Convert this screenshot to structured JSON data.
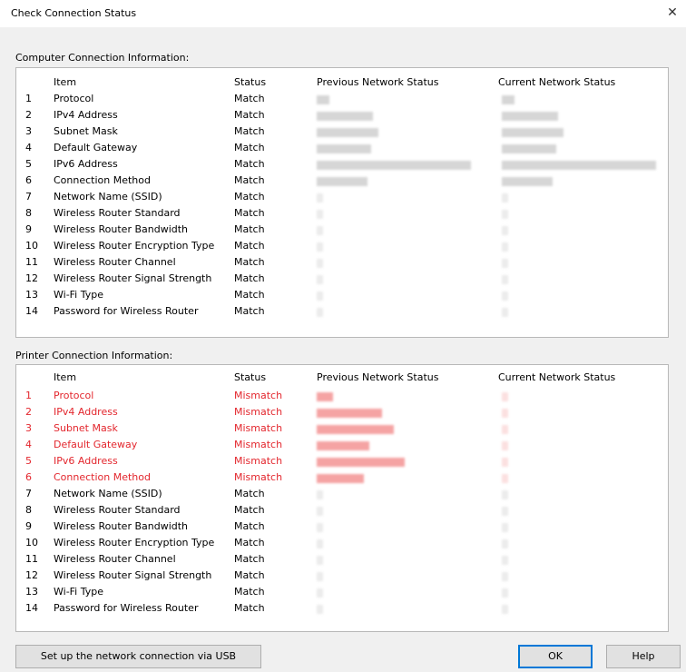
{
  "window": {
    "title": "Check Connection Status",
    "close_glyph": "✕"
  },
  "columns": {
    "item": "Item",
    "status": "Status",
    "previous": "Previous Network Status",
    "current": "Current Network Status"
  },
  "computer": {
    "label": "Computer Connection Information:",
    "rows": [
      {
        "no": "1",
        "item": "Protocol",
        "status": "Match"
      },
      {
        "no": "2",
        "item": "IPv4 Address",
        "status": "Match"
      },
      {
        "no": "3",
        "item": "Subnet Mask",
        "status": "Match"
      },
      {
        "no": "4",
        "item": "Default Gateway",
        "status": "Match"
      },
      {
        "no": "5",
        "item": "IPv6 Address",
        "status": "Match"
      },
      {
        "no": "6",
        "item": "Connection Method",
        "status": "Match"
      },
      {
        "no": "7",
        "item": "Network Name (SSID)",
        "status": "Match"
      },
      {
        "no": "8",
        "item": "Wireless Router Standard",
        "status": "Match"
      },
      {
        "no": "9",
        "item": "Wireless Router Bandwidth",
        "status": "Match"
      },
      {
        "no": "10",
        "item": "Wireless Router Encryption Type",
        "status": "Match"
      },
      {
        "no": "11",
        "item": "Wireless Router Channel",
        "status": "Match"
      },
      {
        "no": "12",
        "item": "Wireless Router Signal Strength",
        "status": "Match"
      },
      {
        "no": "13",
        "item": "Wi-Fi Type",
        "status": "Match"
      },
      {
        "no": "14",
        "item": "Password for Wireless Router",
        "status": "Match"
      }
    ]
  },
  "printer": {
    "label": "Printer Connection Information:",
    "rows": [
      {
        "no": "1",
        "item": "Protocol",
        "status": "Mismatch",
        "mismatch": true
      },
      {
        "no": "2",
        "item": "IPv4 Address",
        "status": "Mismatch",
        "mismatch": true
      },
      {
        "no": "3",
        "item": "Subnet Mask",
        "status": "Mismatch",
        "mismatch": true
      },
      {
        "no": "4",
        "item": "Default Gateway",
        "status": "Mismatch",
        "mismatch": true
      },
      {
        "no": "5",
        "item": "IPv6 Address",
        "status": "Mismatch",
        "mismatch": true
      },
      {
        "no": "6",
        "item": "Connection Method",
        "status": "Mismatch",
        "mismatch": true
      },
      {
        "no": "7",
        "item": "Network Name (SSID)",
        "status": "Match"
      },
      {
        "no": "8",
        "item": "Wireless Router Standard",
        "status": "Match"
      },
      {
        "no": "9",
        "item": "Wireless Router Bandwidth",
        "status": "Match"
      },
      {
        "no": "10",
        "item": "Wireless Router Encryption Type",
        "status": "Match"
      },
      {
        "no": "11",
        "item": "Wireless Router Channel",
        "status": "Match"
      },
      {
        "no": "12",
        "item": "Wireless Router Signal Strength",
        "status": "Match"
      },
      {
        "no": "13",
        "item": "Wi-Fi Type",
        "status": "Match"
      },
      {
        "no": "14",
        "item": "Password for Wireless Router",
        "status": "Match"
      }
    ]
  },
  "buttons": {
    "usb": "Set up the network connection via USB",
    "ok": "OK",
    "help": "Help"
  },
  "colors": {
    "mismatch": "#e3262d",
    "default_button_border": "#0078d7"
  }
}
